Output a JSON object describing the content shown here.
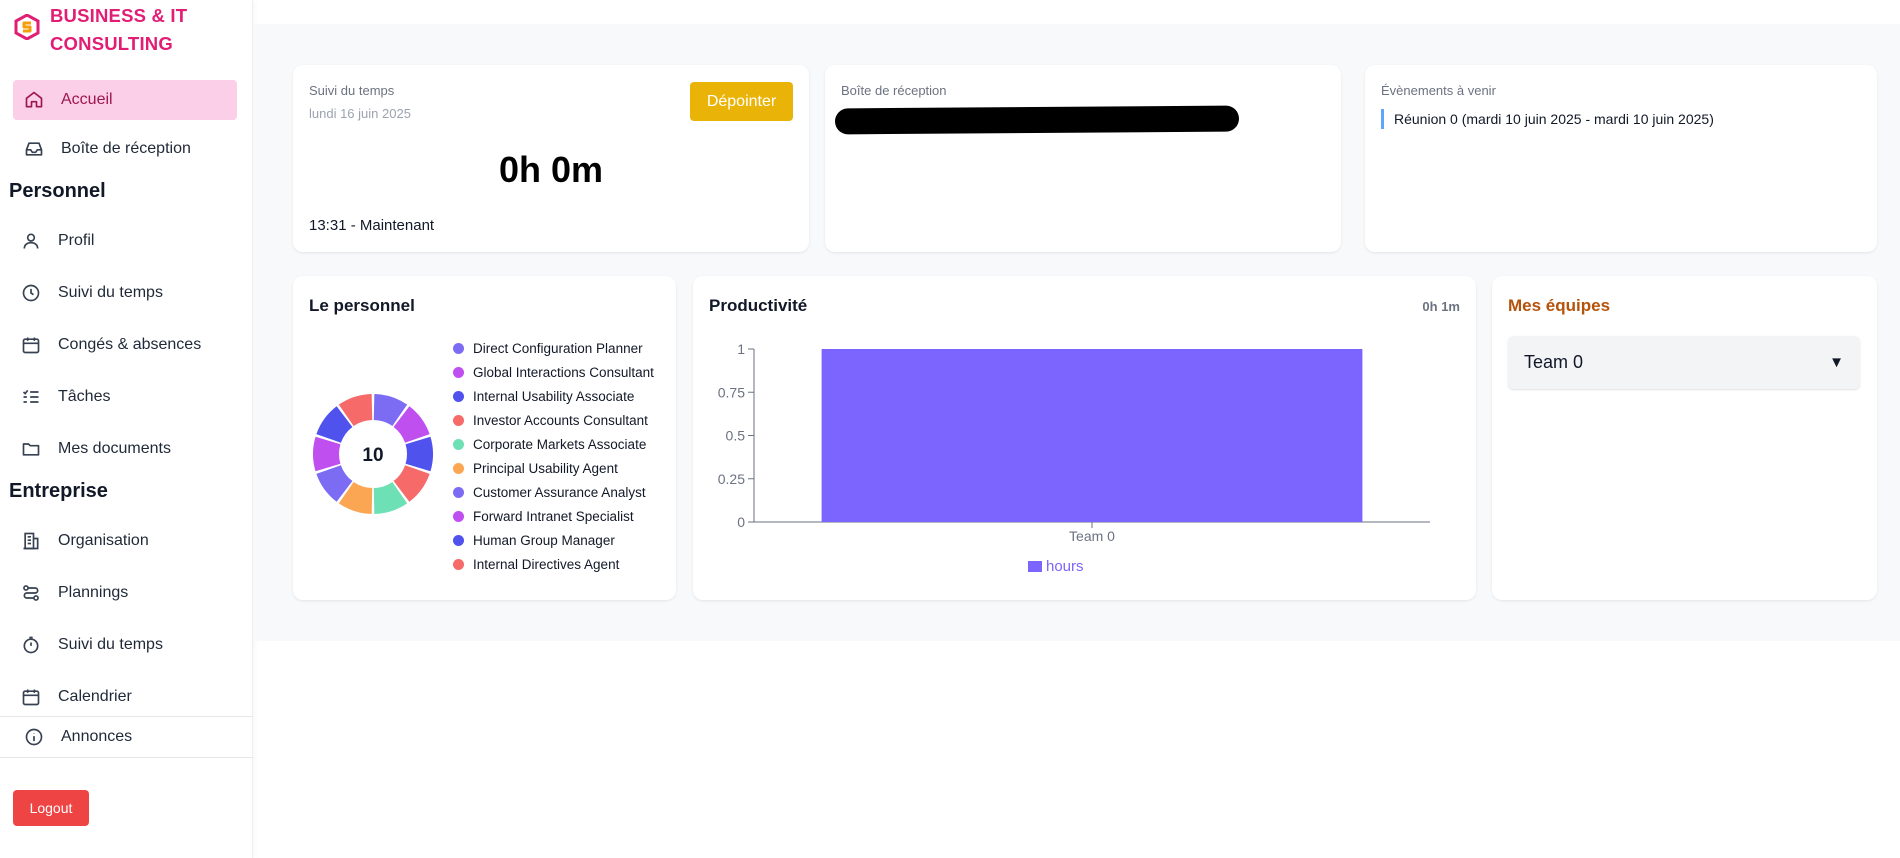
{
  "brand": {
    "line1": "BUSINESS & IT",
    "line2": "CONSULTING",
    "color": "#e11d74"
  },
  "nav": {
    "home": "Accueil",
    "inbox": "Boîte de réception",
    "section_personal": "Personnel",
    "personal": [
      {
        "label": "Profil",
        "icon": "user-icon"
      },
      {
        "label": "Suivi du temps",
        "icon": "clock-icon"
      },
      {
        "label": "Congés & absences",
        "icon": "calendar-icon"
      },
      {
        "label": "Tâches",
        "icon": "task-list-icon"
      },
      {
        "label": "Mes documents",
        "icon": "folder-icon"
      }
    ],
    "section_company": "Entreprise",
    "company": [
      {
        "label": "Organisation",
        "icon": "building-icon"
      },
      {
        "label": "Plannings",
        "icon": "route-icon"
      },
      {
        "label": "Suivi du temps",
        "icon": "stopwatch-icon"
      },
      {
        "label": "Calendrier",
        "icon": "calendar-icon"
      }
    ],
    "announcements": "Annonces",
    "logout": "Logout"
  },
  "time_card": {
    "label": "Suivi du temps",
    "date": "lundi 16 juin 2025",
    "button": "Dépointer",
    "total": "0h 0m",
    "range": "13:31 - Maintenant"
  },
  "inbox_card": {
    "label": "Boîte de réception"
  },
  "events_card": {
    "label": "Évènements à venir",
    "events": [
      "Réunion 0 (mardi 10 juin 2025 - mardi 10 juin 2025)"
    ]
  },
  "staff_card": {
    "title": "Le personnel",
    "count": "10",
    "members": [
      {
        "name": "Direct Configuration Planner",
        "color": "#7c6cf4"
      },
      {
        "name": "Global Interactions Consultant",
        "color": "#c04ff0"
      },
      {
        "name": "Internal Usability Associate",
        "color": "#5052ee"
      },
      {
        "name": "Investor Accounts Consultant",
        "color": "#f66a6a"
      },
      {
        "name": "Corporate Markets Associate",
        "color": "#6ee0b6"
      },
      {
        "name": "Principal Usability Agent",
        "color": "#fba653"
      },
      {
        "name": "Customer Assurance Analyst",
        "color": "#7c6cf4"
      },
      {
        "name": "Forward Intranet Specialist",
        "color": "#c04ff0"
      },
      {
        "name": "Human Group Manager",
        "color": "#5052ee"
      },
      {
        "name": "Internal Directives Agent",
        "color": "#f66a6a"
      }
    ]
  },
  "productivity_card": {
    "title": "Productivité",
    "total": "0h 1m"
  },
  "chart_data": {
    "type": "bar",
    "categories": [
      "Team 0"
    ],
    "series": [
      {
        "name": "hours",
        "values": [
          1
        ],
        "color": "#7c64ff"
      }
    ],
    "ylim": [
      0,
      1
    ],
    "yticks": [
      "0",
      "0.25",
      "0.5",
      "0.75",
      "1"
    ],
    "legend": "bottom"
  },
  "teams_card": {
    "title": "Mes équipes",
    "selected": "Team 0",
    "caret": "▼"
  }
}
